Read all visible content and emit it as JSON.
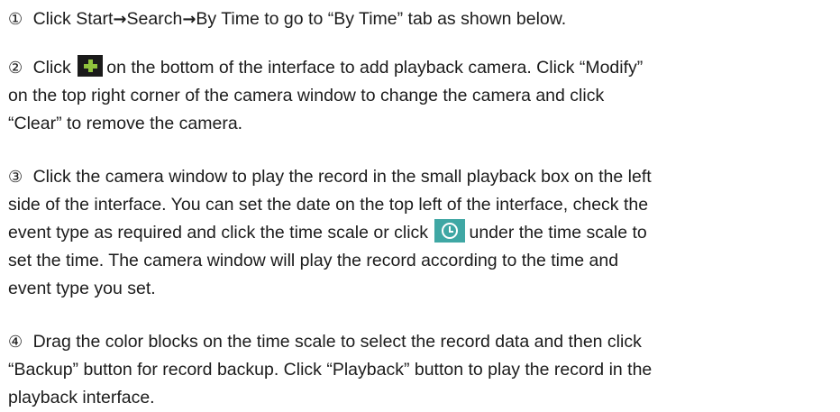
{
  "steps": [
    {
      "number": "①",
      "lines": [
        {
          "pre": "Click Start",
          "arrow1": "→",
          "mid": "Search",
          "arrow2": "→",
          "post": "By Time to go to “By Time” tab as shown below."
        }
      ]
    },
    {
      "number": "②",
      "line1_pre": "Click",
      "line1_post": "on the bottom of the interface to add playback camera. Click “Modify”",
      "line2": "on the top right corner of the camera window to change the camera and click",
      "line3": "“Clear” to remove the camera."
    },
    {
      "number": "③",
      "line1": "Click the camera window to play the record in the small playback box on the left",
      "line2": "side of the interface. You can set the date on the top left of the interface, check the",
      "line3_pre": "event type as required and click the time scale or click",
      "line3_post": "under the time scale to",
      "line4": "set the time. The camera window will play the record according to the time and",
      "line5": "event type you set."
    },
    {
      "number": "④",
      "line1": "Drag the color blocks on the time scale to select the record data and then click",
      "line2": "“Backup” button for record backup. Click “Playback” button to play the record in the",
      "line3": "playback interface."
    }
  ],
  "icons": {
    "add": "plus-icon",
    "time": "clock-icon"
  },
  "colors": {
    "plus_icon_bg": "#1a1a1a",
    "plus_icon_fg": "#8fc23d",
    "clock_icon_bg": "#3fa7a4"
  }
}
